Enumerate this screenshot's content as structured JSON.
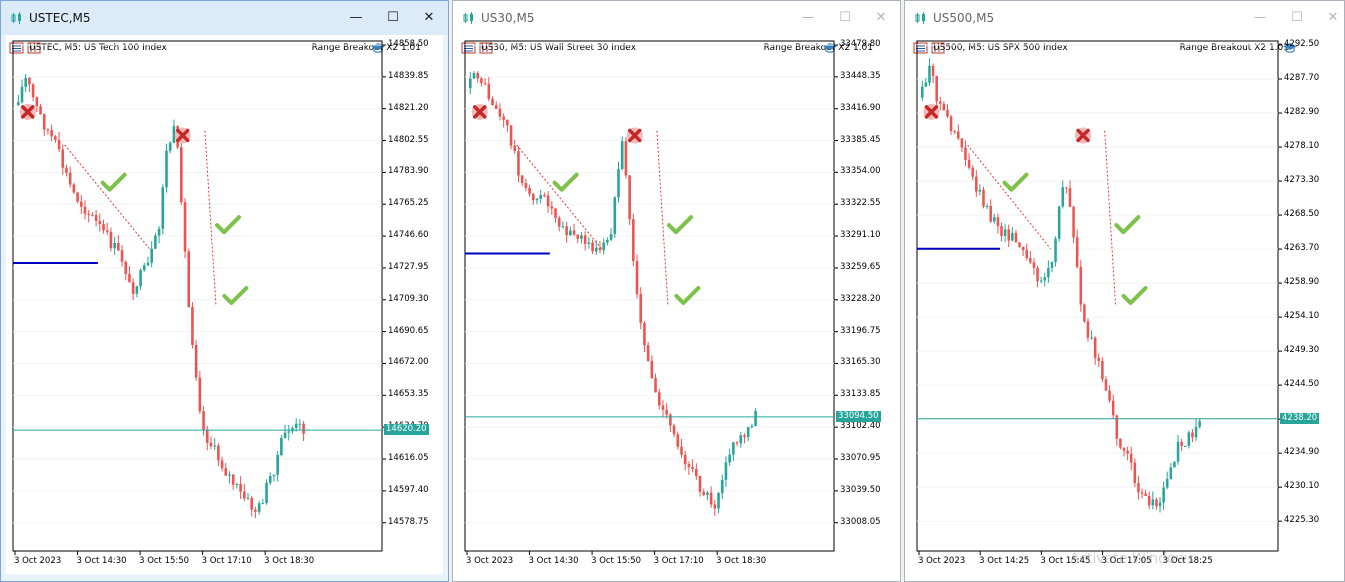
{
  "windows": [
    {
      "id": "ustec",
      "active": true,
      "title": "USTEC,M5",
      "header_left": "USTEC, M5:  US Tech 100 Index",
      "header_right": "Range Breakout X2 1.01",
      "y_labels": [
        "14858.50",
        "14839.85",
        "14821.20",
        "14802.55",
        "14783.90",
        "14765.25",
        "14746.60",
        "14727.95",
        "14709.30",
        "14690.65",
        "14672.00",
        "14653.35",
        "14634.70",
        "14616.05",
        "14597.40",
        "14578.75"
      ],
      "current_price": "14620.20",
      "x_labels": [
        "3 Oct 2023",
        "3 Oct 14:30",
        "3 Oct 15:50",
        "3 Oct 17:10",
        "3 Oct 18:30"
      ],
      "colors": {
        "bull": "#26a69a",
        "bear": "#ef5350",
        "range_line": "#0000c0",
        "price_line": "#26a69a"
      }
    },
    {
      "id": "us30",
      "active": false,
      "title": "US30,M5",
      "header_left": "US30, M5:  US Wall Street 30 Index",
      "header_right": "Range Breakout X2 1.01",
      "y_labels": [
        "33479.80",
        "33448.35",
        "33416.90",
        "33385.45",
        "33354.00",
        "33322.55",
        "33291.10",
        "33259.65",
        "33228.20",
        "33196.75",
        "33165.30",
        "33133.85",
        "33102.40",
        "33070.95",
        "33039.50",
        "33008.05"
      ],
      "current_price": "33094.50",
      "x_labels": [
        "3 Oct 2023",
        "3 Oct 14:30",
        "3 Oct 15:50",
        "3 Oct 17:10",
        "3 Oct 18:30"
      ],
      "colors": {
        "bull": "#26a69a",
        "bear": "#ef5350",
        "range_line": "#0000c0",
        "price_line": "#26a69a"
      }
    },
    {
      "id": "us500",
      "active": false,
      "title": "US500,M5",
      "header_left": "US500, M5:  US SPX 500 Index",
      "header_right": "Range Breakout X2 1.01",
      "y_labels": [
        "4292.50",
        "4287.70",
        "4282.90",
        "4278.10",
        "4273.30",
        "4268.50",
        "4263.70",
        "4258.90",
        "4254.10",
        "4249.30",
        "4244.50",
        "4239.70",
        "4234.90",
        "4230.10",
        "4225.30"
      ],
      "current_price": "4238.20",
      "x_labels": [
        "3 Oct 2023",
        "3 Oct 14:25",
        "3 Oct 15:45",
        "3 Oct 17:05",
        "3 Oct 18:25"
      ],
      "colors": {
        "bull": "#26a69a",
        "bear": "#ef5350",
        "range_line": "#0000c0",
        "price_line": "#26a69a"
      }
    }
  ],
  "watermark": "Activate Windows",
  "icons": {
    "window": "chart-bars-icon",
    "minimize": "minimize-icon",
    "maximize": "maximize-icon",
    "close": "close-icon",
    "ea": "graduation-cap-icon",
    "trade_loss": "cross-icon",
    "trade_win": "check-icon"
  }
}
